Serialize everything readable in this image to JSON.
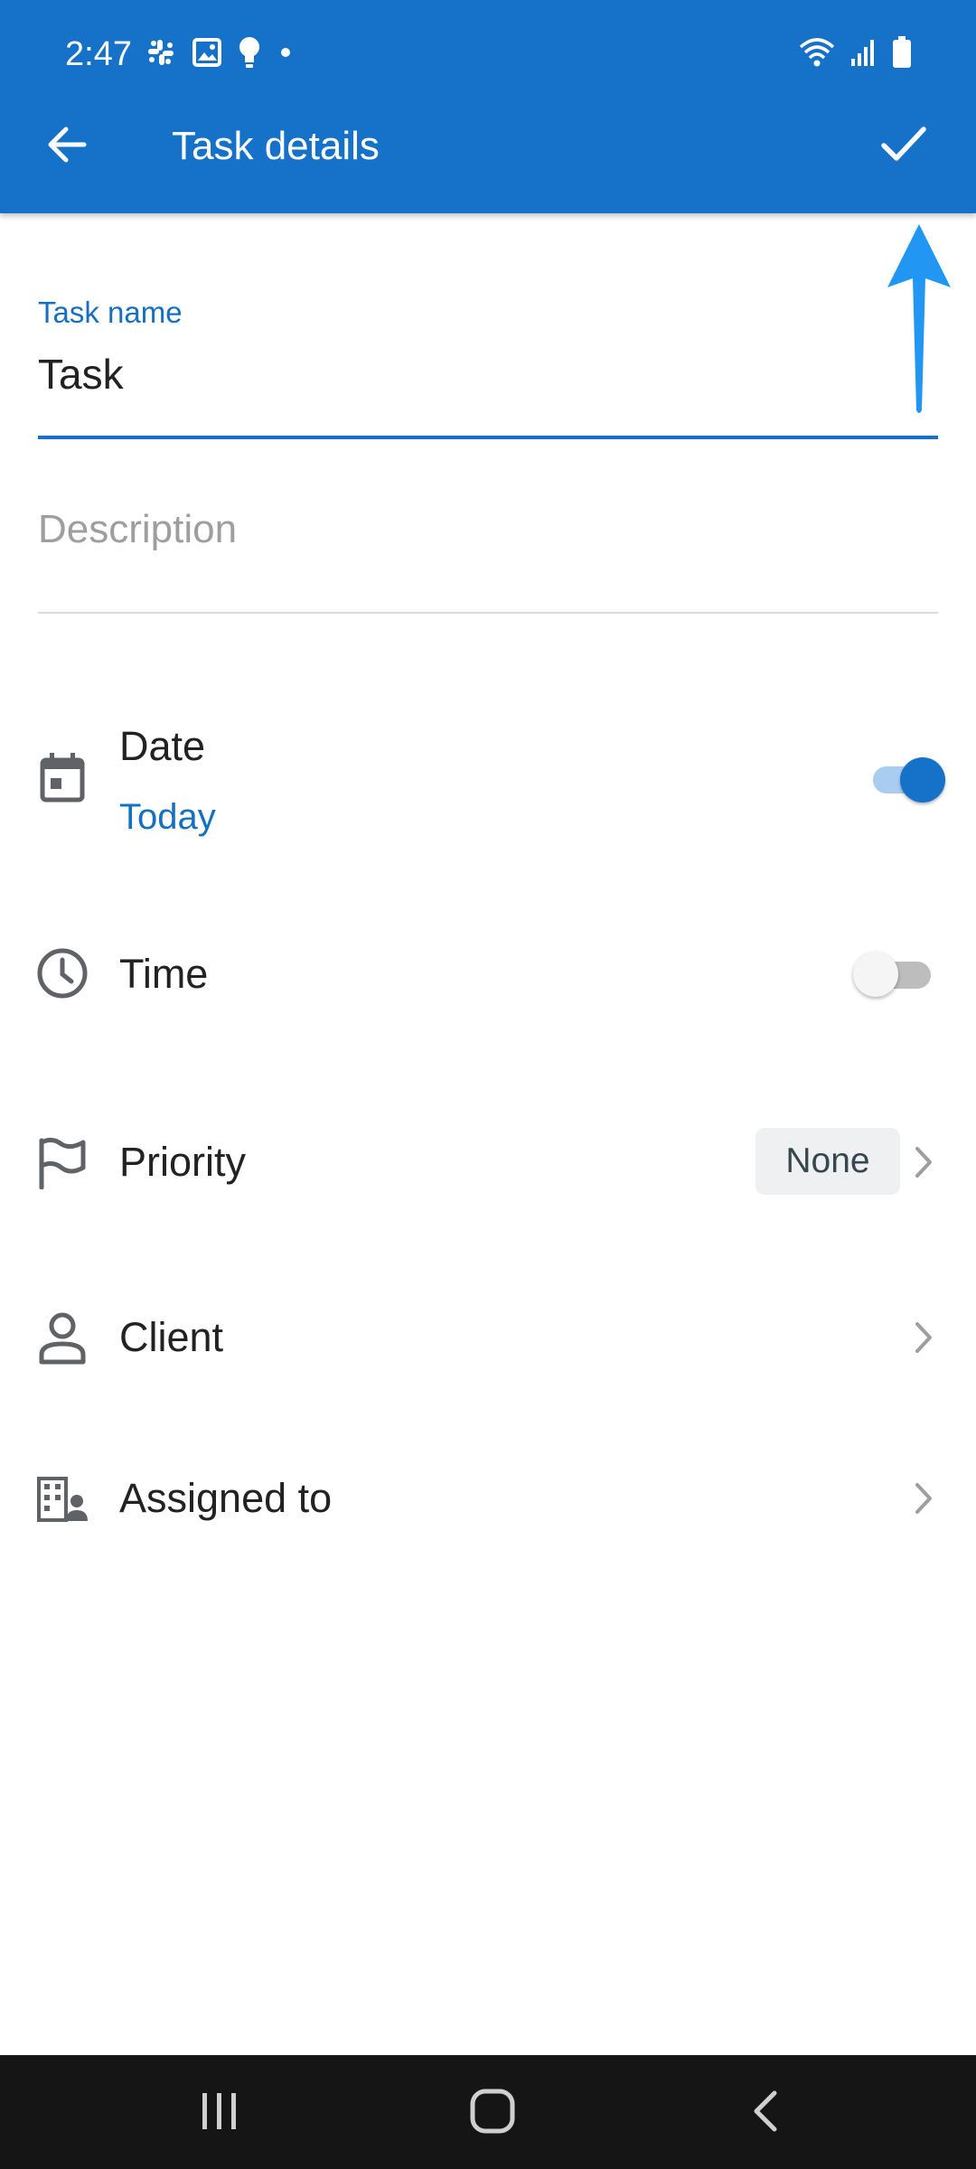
{
  "status_bar": {
    "time": "2:47",
    "left_icons": [
      "slack-icon",
      "image-icon",
      "bulb-icon",
      "dot-icon"
    ],
    "right_icons": [
      "wifi-icon",
      "signal-icon",
      "battery-icon"
    ]
  },
  "app_bar": {
    "title": "Task details",
    "back_icon": "arrow-back-icon",
    "confirm_icon": "check-icon",
    "background": "#1672c8"
  },
  "form": {
    "task_name": {
      "label": "Task name",
      "value": "Task"
    },
    "description": {
      "placeholder": "Description",
      "value": ""
    }
  },
  "rows": {
    "date": {
      "label": "Date",
      "value": "Today",
      "toggle_on": true,
      "icon": "calendar-icon"
    },
    "time": {
      "label": "Time",
      "toggle_on": false,
      "icon": "clock-icon"
    },
    "priority": {
      "label": "Priority",
      "value": "None",
      "icon": "flag-icon"
    },
    "client": {
      "label": "Client",
      "icon": "person-icon"
    },
    "assigned_to": {
      "label": "Assigned to",
      "icon": "building-person-icon"
    }
  },
  "annotation": {
    "icon": "up-arrow-annotation",
    "color": "#2196f3"
  },
  "nav_bar": {
    "buttons": [
      "recents-icon",
      "home-icon",
      "back-icon"
    ]
  },
  "colors": {
    "accent": "#1672c8",
    "label_blue": "#1670c0",
    "text": "#222222"
  }
}
